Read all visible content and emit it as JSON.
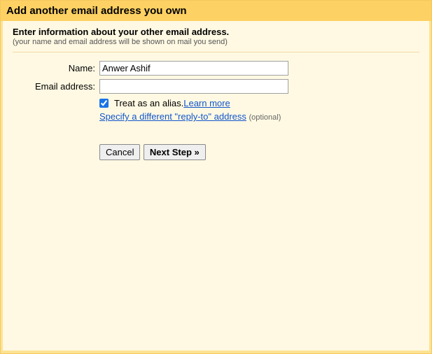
{
  "title": "Add another email address you own",
  "subtitle": "Enter information about your other email address.",
  "subnote": "(your name and email address will be shown on mail you send)",
  "form": {
    "name_label": "Name:",
    "name_value": "Anwer Ashif",
    "email_label": "Email address:",
    "email_value": "",
    "alias_label": "Treat as an alias. ",
    "learn_more": "Learn more",
    "reply_to_link": "Specify a different \"reply-to\" address",
    "reply_to_optional": "(optional)"
  },
  "buttons": {
    "cancel": "Cancel",
    "next": "Next Step »"
  }
}
